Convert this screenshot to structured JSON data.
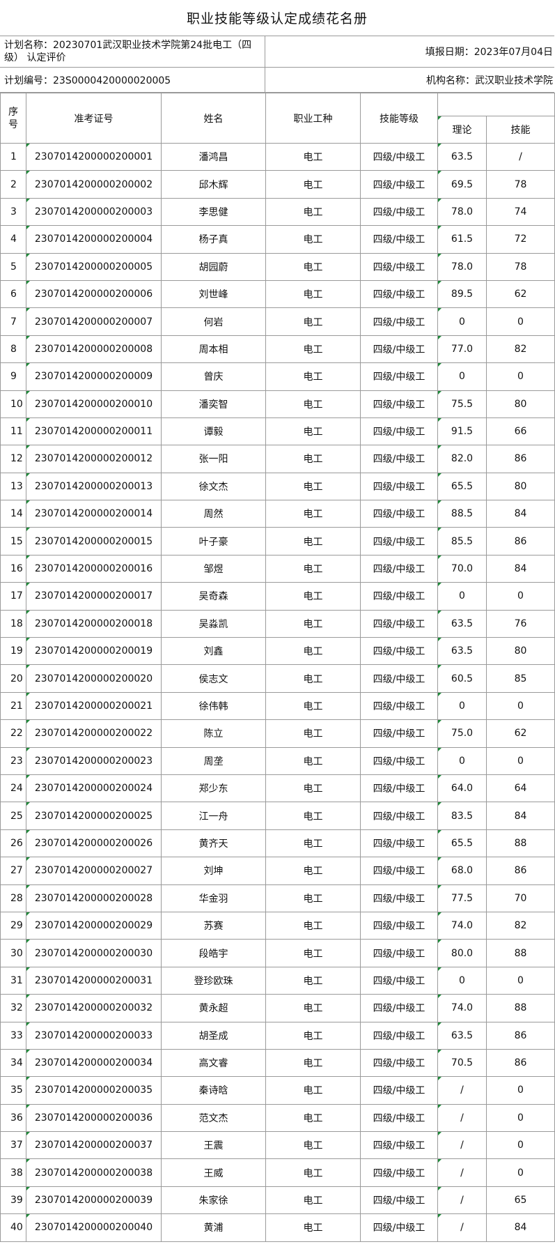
{
  "title": "职业技能等级认定成绩花名册",
  "plan_name": "计划名称：20230701武汉职业技术学院第24批电工（四级） 认定评价",
  "fill_date": "填报日期：2023年07月04日",
  "plan_code": "计划编号：23S0000420000020005",
  "org_name": "机构名称：武汉职业技术学院",
  "headers": {
    "seq": "序号",
    "exam_no": "准考证号",
    "name": "姓名",
    "occupation": "职业工种",
    "level": "技能等级",
    "theory": "理论",
    "skill": "技能"
  },
  "rows": [
    {
      "seq": "1",
      "exam_no": "2307014200000200001",
      "name": "潘鸿昌",
      "occupation": "电工",
      "level": "四级/中级工",
      "theory": "63.5",
      "skill": "/"
    },
    {
      "seq": "2",
      "exam_no": "2307014200000200002",
      "name": "邱木辉",
      "occupation": "电工",
      "level": "四级/中级工",
      "theory": "69.5",
      "skill": "78"
    },
    {
      "seq": "3",
      "exam_no": "2307014200000200003",
      "name": "李思健",
      "occupation": "电工",
      "level": "四级/中级工",
      "theory": "78.0",
      "skill": "74"
    },
    {
      "seq": "4",
      "exam_no": "2307014200000200004",
      "name": "杨子真",
      "occupation": "电工",
      "level": "四级/中级工",
      "theory": "61.5",
      "skill": "72"
    },
    {
      "seq": "5",
      "exam_no": "2307014200000200005",
      "name": "胡园蔚",
      "occupation": "电工",
      "level": "四级/中级工",
      "theory": "78.0",
      "skill": "78"
    },
    {
      "seq": "6",
      "exam_no": "2307014200000200006",
      "name": "刘世峰",
      "occupation": "电工",
      "level": "四级/中级工",
      "theory": "89.5",
      "skill": "62"
    },
    {
      "seq": "7",
      "exam_no": "2307014200000200007",
      "name": "何岩",
      "occupation": "电工",
      "level": "四级/中级工",
      "theory": "0",
      "skill": "0"
    },
    {
      "seq": "8",
      "exam_no": "2307014200000200008",
      "name": "周本相",
      "occupation": "电工",
      "level": "四级/中级工",
      "theory": "77.0",
      "skill": "82"
    },
    {
      "seq": "9",
      "exam_no": "2307014200000200009",
      "name": "曾庆",
      "occupation": "电工",
      "level": "四级/中级工",
      "theory": "0",
      "skill": "0"
    },
    {
      "seq": "10",
      "exam_no": "2307014200000200010",
      "name": "潘奕智",
      "occupation": "电工",
      "level": "四级/中级工",
      "theory": "75.5",
      "skill": "80"
    },
    {
      "seq": "11",
      "exam_no": "2307014200000200011",
      "name": "谭毅",
      "occupation": "电工",
      "level": "四级/中级工",
      "theory": "91.5",
      "skill": "66"
    },
    {
      "seq": "12",
      "exam_no": "2307014200000200012",
      "name": "张一阳",
      "occupation": "电工",
      "level": "四级/中级工",
      "theory": "82.0",
      "skill": "86"
    },
    {
      "seq": "13",
      "exam_no": "2307014200000200013",
      "name": "徐文杰",
      "occupation": "电工",
      "level": "四级/中级工",
      "theory": "65.5",
      "skill": "80"
    },
    {
      "seq": "14",
      "exam_no": "2307014200000200014",
      "name": "周然",
      "occupation": "电工",
      "level": "四级/中级工",
      "theory": "88.5",
      "skill": "84"
    },
    {
      "seq": "15",
      "exam_no": "2307014200000200015",
      "name": "叶子豪",
      "occupation": "电工",
      "level": "四级/中级工",
      "theory": "85.5",
      "skill": "86"
    },
    {
      "seq": "16",
      "exam_no": "2307014200000200016",
      "name": "邹煜",
      "occupation": "电工",
      "level": "四级/中级工",
      "theory": "70.0",
      "skill": "84"
    },
    {
      "seq": "17",
      "exam_no": "2307014200000200017",
      "name": "吴奇森",
      "occupation": "电工",
      "level": "四级/中级工",
      "theory": "0",
      "skill": "0"
    },
    {
      "seq": "18",
      "exam_no": "2307014200000200018",
      "name": "吴淼凯",
      "occupation": "电工",
      "level": "四级/中级工",
      "theory": "63.5",
      "skill": "76"
    },
    {
      "seq": "19",
      "exam_no": "2307014200000200019",
      "name": "刘鑫",
      "occupation": "电工",
      "level": "四级/中级工",
      "theory": "63.5",
      "skill": "80"
    },
    {
      "seq": "20",
      "exam_no": "2307014200000200020",
      "name": "侯志文",
      "occupation": "电工",
      "level": "四级/中级工",
      "theory": "60.5",
      "skill": "85"
    },
    {
      "seq": "21",
      "exam_no": "2307014200000200021",
      "name": "徐伟韩",
      "occupation": "电工",
      "level": "四级/中级工",
      "theory": "0",
      "skill": "0"
    },
    {
      "seq": "22",
      "exam_no": "2307014200000200022",
      "name": "陈立",
      "occupation": "电工",
      "level": "四级/中级工",
      "theory": "75.0",
      "skill": "62"
    },
    {
      "seq": "23",
      "exam_no": "2307014200000200023",
      "name": "周垄",
      "occupation": "电工",
      "level": "四级/中级工",
      "theory": "0",
      "skill": "0"
    },
    {
      "seq": "24",
      "exam_no": "2307014200000200024",
      "name": "郑少东",
      "occupation": "电工",
      "level": "四级/中级工",
      "theory": "64.0",
      "skill": "64"
    },
    {
      "seq": "25",
      "exam_no": "2307014200000200025",
      "name": "江一舟",
      "occupation": "电工",
      "level": "四级/中级工",
      "theory": "83.5",
      "skill": "84"
    },
    {
      "seq": "26",
      "exam_no": "2307014200000200026",
      "name": "黄齐天",
      "occupation": "电工",
      "level": "四级/中级工",
      "theory": "65.5",
      "skill": "88"
    },
    {
      "seq": "27",
      "exam_no": "2307014200000200027",
      "name": "刘坤",
      "occupation": "电工",
      "level": "四级/中级工",
      "theory": "68.0",
      "skill": "86"
    },
    {
      "seq": "28",
      "exam_no": "2307014200000200028",
      "name": "华金羽",
      "occupation": "电工",
      "level": "四级/中级工",
      "theory": "77.5",
      "skill": "70"
    },
    {
      "seq": "29",
      "exam_no": "2307014200000200029",
      "name": "苏赛",
      "occupation": "电工",
      "level": "四级/中级工",
      "theory": "74.0",
      "skill": "82"
    },
    {
      "seq": "30",
      "exam_no": "2307014200000200030",
      "name": "段皓宇",
      "occupation": "电工",
      "level": "四级/中级工",
      "theory": "80.0",
      "skill": "88"
    },
    {
      "seq": "31",
      "exam_no": "2307014200000200031",
      "name": "登珍欧珠",
      "occupation": "电工",
      "level": "四级/中级工",
      "theory": "0",
      "skill": "0"
    },
    {
      "seq": "32",
      "exam_no": "2307014200000200032",
      "name": "黄永超",
      "occupation": "电工",
      "level": "四级/中级工",
      "theory": "74.0",
      "skill": "88"
    },
    {
      "seq": "33",
      "exam_no": "2307014200000200033",
      "name": "胡圣成",
      "occupation": "电工",
      "level": "四级/中级工",
      "theory": "63.5",
      "skill": "86"
    },
    {
      "seq": "34",
      "exam_no": "2307014200000200034",
      "name": "高文睿",
      "occupation": "电工",
      "level": "四级/中级工",
      "theory": "70.5",
      "skill": "86"
    },
    {
      "seq": "35",
      "exam_no": "2307014200000200035",
      "name": "秦诗晗",
      "occupation": "电工",
      "level": "四级/中级工",
      "theory": "/",
      "skill": "0"
    },
    {
      "seq": "36",
      "exam_no": "2307014200000200036",
      "name": "范文杰",
      "occupation": "电工",
      "level": "四级/中级工",
      "theory": "/",
      "skill": "0"
    },
    {
      "seq": "37",
      "exam_no": "2307014200000200037",
      "name": "王震",
      "occupation": "电工",
      "level": "四级/中级工",
      "theory": "/",
      "skill": "0"
    },
    {
      "seq": "38",
      "exam_no": "2307014200000200038",
      "name": "王威",
      "occupation": "电工",
      "level": "四级/中级工",
      "theory": "/",
      "skill": "0"
    },
    {
      "seq": "39",
      "exam_no": "2307014200000200039",
      "name": "朱家徐",
      "occupation": "电工",
      "level": "四级/中级工",
      "theory": "/",
      "skill": "65"
    },
    {
      "seq": "40",
      "exam_no": "2307014200000200040",
      "name": "黄浦",
      "occupation": "电工",
      "level": "四级/中级工",
      "theory": "/",
      "skill": "84"
    }
  ]
}
